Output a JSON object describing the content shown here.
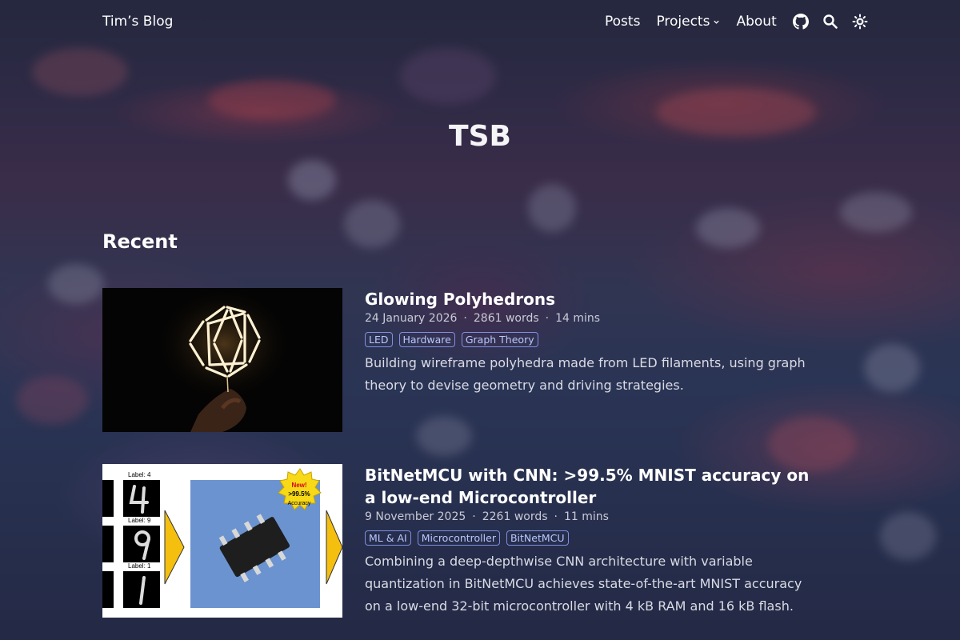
{
  "header": {
    "brand": "Tim’s Blog",
    "nav": [
      {
        "label": "Posts"
      },
      {
        "label": "Projects",
        "dropdown": true
      },
      {
        "label": "About"
      }
    ],
    "icons": [
      "github-icon",
      "search-icon",
      "theme-toggle-icon"
    ]
  },
  "hero": {
    "title": "TSB"
  },
  "recent": {
    "heading": "Recent",
    "posts": [
      {
        "title": "Glowing Polyhedrons",
        "date": "24 January 2026",
        "words": "2861 words",
        "read_time": "14 mins",
        "tags": [
          "LED",
          "Hardware",
          "Graph Theory"
        ],
        "summary": "Building wireframe polyhedra made from LED filaments, using graph theory to devise geometry and driving strategies."
      },
      {
        "title": "BitNetMCU with CNN: >99.5% MNIST accuracy on a low-end Microcontroller",
        "date": "9 November 2025",
        "words": "2261 words",
        "read_time": "11 mins",
        "tags": [
          "ML & AI",
          "Microcontroller",
          "BitNetMCU"
        ],
        "summary": "Combining a deep-depthwise CNN architecture with variable quantization in BitNetMCU achieves state-of-the-art MNIST accuracy on a low-end 32-bit microcontroller with 4 kB RAM and 16 kB flash.",
        "thumb_text": {
          "labels": [
            "Label: 4",
            "Label: 9",
            "Label: 1"
          ],
          "badge_new": "New!",
          "badge_value": ">99.5%",
          "badge_caption": "Accuracy"
        }
      }
    ]
  },
  "colors": {
    "tag_border": "#7f8fe0",
    "tag_text": "#b9c7ff",
    "badge_yellow": "#f7d917",
    "arrow_yellow": "#f5bf10"
  }
}
